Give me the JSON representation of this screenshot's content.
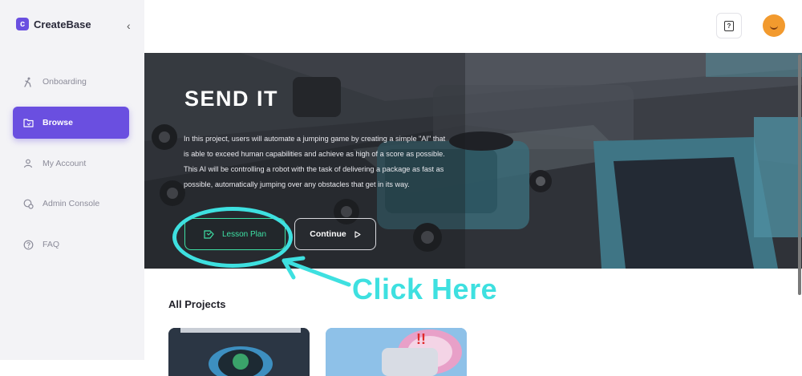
{
  "app": {
    "name": "CreateBase"
  },
  "sidebar": {
    "items": [
      {
        "label": "Onboarding",
        "icon": "person-walking-icon",
        "active": false
      },
      {
        "label": "Browse",
        "icon": "folder-icon",
        "active": true
      },
      {
        "label": "My Account",
        "icon": "user-icon",
        "active": false
      },
      {
        "label": "Admin Console",
        "icon": "admin-icon",
        "active": false
      },
      {
        "label": "FAQ",
        "icon": "question-icon",
        "active": false
      }
    ]
  },
  "header": {
    "help_icon": "help-icon",
    "avatar_color": "#f29a2e"
  },
  "hero": {
    "title": "SEND IT",
    "description": "In this project, users will automate a jumping game by creating a simple \"AI\" that is able to exceed human capabilities and achieve as high of a score as possible. This AI will be controlling a robot with the task of delivering a package as fast as possible, automatically jumping over any obstacles that get in its way.",
    "lesson_plan_label": "Lesson Plan",
    "continue_label": "Continue"
  },
  "annotation": {
    "text": "Click Here",
    "color": "#3ee0e0"
  },
  "projects": {
    "title": "All Projects"
  },
  "colors": {
    "accent": "#6a4fe0",
    "lesson_green": "#3ee0a5"
  }
}
